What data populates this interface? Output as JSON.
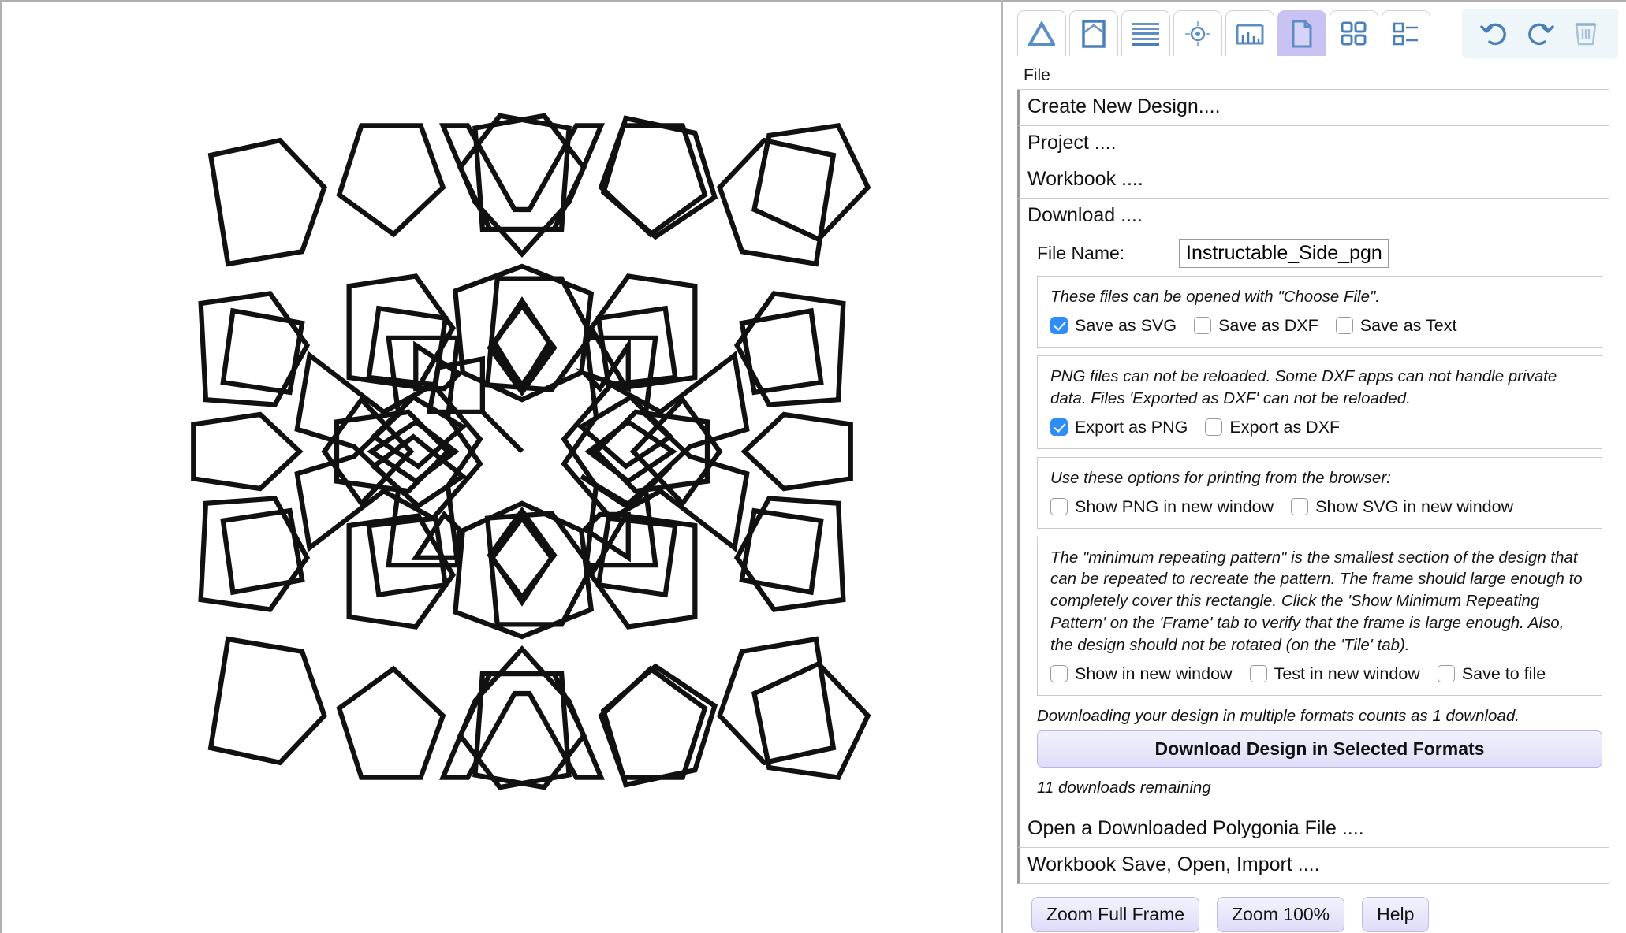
{
  "toolbar": {
    "tools": [
      {
        "name": "triangle-tool",
        "icon": "triangle-icon",
        "active": false
      },
      {
        "name": "frame-tool",
        "icon": "frame-icon",
        "active": false
      },
      {
        "name": "lines-tool",
        "icon": "lines-icon",
        "active": false
      },
      {
        "name": "target-tool",
        "icon": "target-icon",
        "active": false
      },
      {
        "name": "ruler-tool",
        "icon": "ruler-icon",
        "active": false
      },
      {
        "name": "file-tool",
        "icon": "file-icon",
        "active": true
      },
      {
        "name": "grid-tool",
        "icon": "grid-icon",
        "active": false
      },
      {
        "name": "list-tool",
        "icon": "list-icon",
        "active": false
      }
    ],
    "actions": [
      {
        "name": "undo-button",
        "icon": "undo-icon"
      },
      {
        "name": "redo-button",
        "icon": "redo-icon"
      },
      {
        "name": "delete-button",
        "icon": "trash-icon"
      }
    ]
  },
  "panel": {
    "section_label": "File",
    "menu": {
      "create_new_design": "Create New Design....",
      "project": "Project ....",
      "workbook": "Workbook ....",
      "download": "Download ....",
      "open_downloaded": "Open a Downloaded Polygonia File ....",
      "workbook_save": "Workbook Save, Open, Import ...."
    },
    "download": {
      "file_name_label": "File Name:",
      "file_name_value": "Instructable_Side_pgnia",
      "file_name_placeholder": "Instructable_Side_pgnia",
      "save_group": {
        "note": "These files can be opened with \"Choose File\".",
        "options": [
          {
            "label": "Save as SVG",
            "checked": true
          },
          {
            "label": "Save as DXF",
            "checked": false
          },
          {
            "label": "Save as Text",
            "checked": false
          }
        ]
      },
      "export_group": {
        "note": "PNG files can not be reloaded. Some DXF apps can not handle private data. Files 'Exported as DXF' can not be reloaded.",
        "options": [
          {
            "label": "Export as PNG",
            "checked": true
          },
          {
            "label": "Export as DXF",
            "checked": false
          }
        ]
      },
      "print_group": {
        "note": "Use these options for printing from the browser:",
        "options": [
          {
            "label": "Show PNG in new window",
            "checked": false
          },
          {
            "label": "Show SVG in new window",
            "checked": false
          }
        ]
      },
      "pattern_group": {
        "note": "The \"minimum repeating pattern\" is the smallest section of the design that can be repeated to recreate the pattern. The frame should large enough to completely cover this rectangle. Click the 'Show Minimum Repeating Pattern' on the 'Frame' tab to verify that the frame is large enough. Also, the design should not be rotated (on the 'Tile' tab).",
        "options": [
          {
            "label": "Show in new window",
            "checked": false
          },
          {
            "label": "Test in new window",
            "checked": false
          },
          {
            "label": "Save to file",
            "checked": false
          }
        ]
      },
      "download_note": "Downloading your design in multiple formats counts as 1 download.",
      "download_button": "Download Design in Selected Formats",
      "downloads_remaining": "11 downloads remaining"
    }
  },
  "bottom_bar": {
    "buttons": [
      {
        "label": "Zoom Full Frame",
        "name": "zoom-full-frame-button"
      },
      {
        "label": "Zoom 100%",
        "name": "zoom-100-button"
      },
      {
        "label": "Help",
        "name": "help-button"
      }
    ]
  },
  "canvas": {
    "design_name": "islamic-geometric-star-pattern",
    "stroke_color": "#111111",
    "fill_color": "#ffffff",
    "stroke_width": 4
  },
  "colors": {
    "accent": "#2e8df7",
    "active_tab": "#c9c3f3",
    "toolbar_icon": "#5b8ec4",
    "button_gradient_top": "#f3f3fd",
    "button_gradient_bottom": "#dedcf8"
  }
}
